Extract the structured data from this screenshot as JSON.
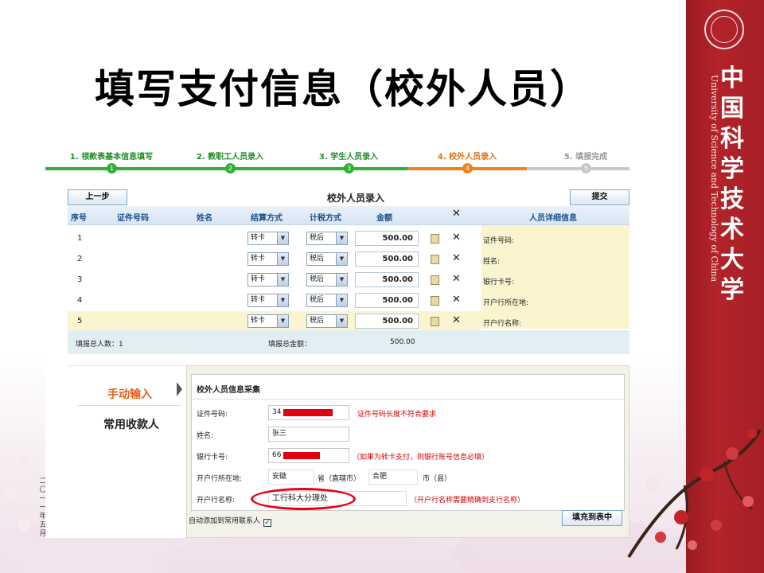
{
  "slide": {
    "title": "填写支付信息（校外人员）",
    "side_date": "二〇一一年五月"
  },
  "banner": {
    "chinese_name": "中国科学技术大学",
    "english_name": "University of Science and Technology of China",
    "color": "#a61f26"
  },
  "steps": [
    {
      "label": "1. 领款表基本信息填写",
      "number": "1",
      "state": "done"
    },
    {
      "label": "2. 教职工人员录入",
      "number": "2",
      "state": "done"
    },
    {
      "label": "3. 学生人员录入",
      "number": "3",
      "state": "done"
    },
    {
      "label": "4. 校外人员录入",
      "number": "4",
      "state": "current"
    },
    {
      "label": "5. 填报完成",
      "number": "5",
      "state": "pending"
    }
  ],
  "colors": {
    "done": "#2eb135",
    "current": "#f08219",
    "pending": "#c8c8c8"
  },
  "toolbar": {
    "prev_label": "上一步",
    "submit_label": "提交",
    "grid_title": "校外人员录入"
  },
  "grid": {
    "columns": [
      "序号",
      "证件号码",
      "姓名",
      "结算方式",
      "计税方式",
      "金额"
    ],
    "delete_all_symbol": "✕",
    "detail_header": "人员详细信息",
    "rows": [
      {
        "index": "1",
        "settle": "转卡",
        "tax": "税后",
        "amount": "500.00"
      },
      {
        "index": "2",
        "settle": "转卡",
        "tax": "税后",
        "amount": "500.00"
      },
      {
        "index": "3",
        "settle": "转卡",
        "tax": "税后",
        "amount": "500.00"
      },
      {
        "index": "4",
        "settle": "转卡",
        "tax": "税后",
        "amount": "500.00"
      },
      {
        "index": "5",
        "settle": "转卡",
        "tax": "税后",
        "amount": "500.00"
      }
    ],
    "detail_labels": [
      "证件号码:",
      "姓名:",
      "银行卡号:",
      "开户行所在地:",
      "开户行名称:"
    ],
    "footer": {
      "count_label": "填报总人数：1",
      "total_label": "填报总金额：",
      "total_value": "500.00"
    }
  },
  "form": {
    "tab_manual": "手动输入",
    "tab_common": "常用收款人",
    "title": "校外人员信息采集",
    "id_label": "证件号码:",
    "id_value": "34",
    "id_error": "证件号码长度不符合要求",
    "name_label": "姓名:",
    "name_value": "张三",
    "card_label": "银行卡号:",
    "card_value": "66",
    "card_hint": "（如果为转卡支付，则银行账号信息必填）",
    "location_label": "开户行所在地:",
    "province_value": "安徽",
    "province_suffix": "省（直辖市）",
    "city_value": "合肥",
    "city_suffix": "市（县）",
    "bank_label": "开户行名称:",
    "bank_value": "工行科大分理处",
    "bank_hint": "（开户行名称需要精确到支行名称）",
    "auto_add_label": "自动添加到常用联系人",
    "auto_add_checked": "✓",
    "fill_button": "填充到表中"
  }
}
